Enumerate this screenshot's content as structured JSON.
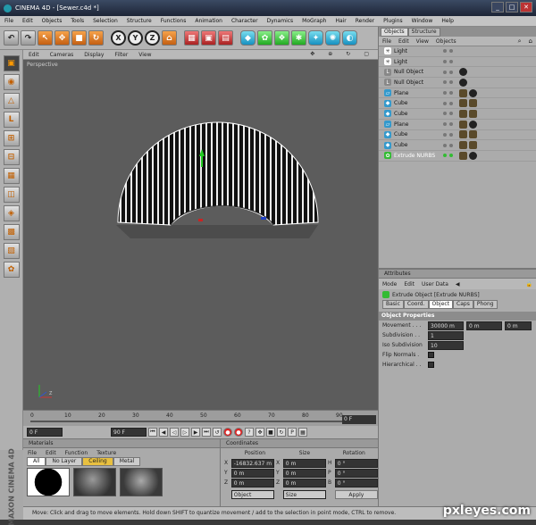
{
  "window": {
    "app": "CINEMA 4D",
    "file": "[Sewer.c4d *]",
    "controls": [
      "_",
      "□",
      "✕"
    ]
  },
  "menu": [
    "File",
    "Edit",
    "Objects",
    "Tools",
    "Selection",
    "Structure",
    "Functions",
    "Animation",
    "Character",
    "Dynamics",
    "MoGraph",
    "Hair",
    "Render",
    "Plugins",
    "Window",
    "Help"
  ],
  "toolbar": {
    "axis_labels": [
      "X",
      "Y",
      "Z"
    ]
  },
  "viewport": {
    "menu": [
      "Edit",
      "Cameras",
      "Display",
      "Filter",
      "View"
    ],
    "label": "Perspective",
    "nav_icons": [
      "move-icon",
      "zoom-icon",
      "rotate-icon",
      "maximize-icon"
    ]
  },
  "timeline": {
    "ticks": [
      "0",
      "10",
      "20",
      "30",
      "40",
      "50",
      "60",
      "70",
      "80",
      "90"
    ],
    "frame": "0 F"
  },
  "playback": {
    "start": "0 F",
    "end": "90 F"
  },
  "materials": {
    "title": "Materials",
    "menu": [
      "File",
      "Edit",
      "Function",
      "Texture"
    ],
    "tabs": [
      "All",
      "No Layer",
      "Ceiling",
      "Metal"
    ]
  },
  "coordinates": {
    "title": "Coordinates",
    "headers": [
      "Position",
      "Size",
      "Rotation"
    ],
    "rows": [
      {
        "axis": "X",
        "pos": "-16832.637 m",
        "size": "0 m",
        "rot_axis": "H",
        "rot": "0 °"
      },
      {
        "axis": "Y",
        "pos": "0 m",
        "size": "0 m",
        "rot_axis": "P",
        "rot": "0 °"
      },
      {
        "axis": "Z",
        "pos": "0 m",
        "size": "0 m",
        "rot_axis": "B",
        "rot": "0 °"
      }
    ],
    "mode": "Object",
    "size_mode": "Size",
    "apply": "Apply"
  },
  "status": "Move: Click and drag to move elements. Hold down SHIFT to quantize movement / add to the selection in point mode, CTRL to remove.",
  "logo": "MAXON CINEMA 4D",
  "objects": {
    "tabs": [
      "Objects",
      "Structure"
    ],
    "menu": [
      "File",
      "Edit",
      "View",
      "Objects"
    ],
    "items": [
      {
        "name": "Light",
        "icon": "light-icon"
      },
      {
        "name": "Light",
        "icon": "light-icon"
      },
      {
        "name": "Null Object",
        "icon": "null-icon"
      },
      {
        "name": "Null Object",
        "icon": "null-icon"
      },
      {
        "name": "Plane",
        "icon": "plane-icon"
      },
      {
        "name": "Cube",
        "icon": "cube-icon"
      },
      {
        "name": "Cube",
        "icon": "cube-icon"
      },
      {
        "name": "Plane",
        "icon": "plane-icon"
      },
      {
        "name": "Cube",
        "icon": "cube-icon"
      },
      {
        "name": "Cube",
        "icon": "cube-icon"
      },
      {
        "name": "Extrude NURBS",
        "icon": "extrude-icon"
      }
    ]
  },
  "attributes": {
    "title": "Attributes",
    "menu": [
      "Mode",
      "Edit",
      "User Data"
    ],
    "object_title": "Extrude Object [Extrude NURBS]",
    "tabs": [
      "Basic",
      "Coord.",
      "Object",
      "Caps",
      "Phong"
    ],
    "section": "Object Properties",
    "movement": {
      "label": "Movement . . .",
      "x": "30000 m",
      "y": "0 m",
      "z": "0 m"
    },
    "subdivision": {
      "label": "Subdivision . .",
      "value": "1"
    },
    "iso": {
      "label": "Iso Subdivision",
      "value": "10"
    },
    "flip": {
      "label": "Flip Normals ."
    },
    "hier": {
      "label": "Hierarchical . ."
    }
  },
  "watermark": "pxleyes.com"
}
